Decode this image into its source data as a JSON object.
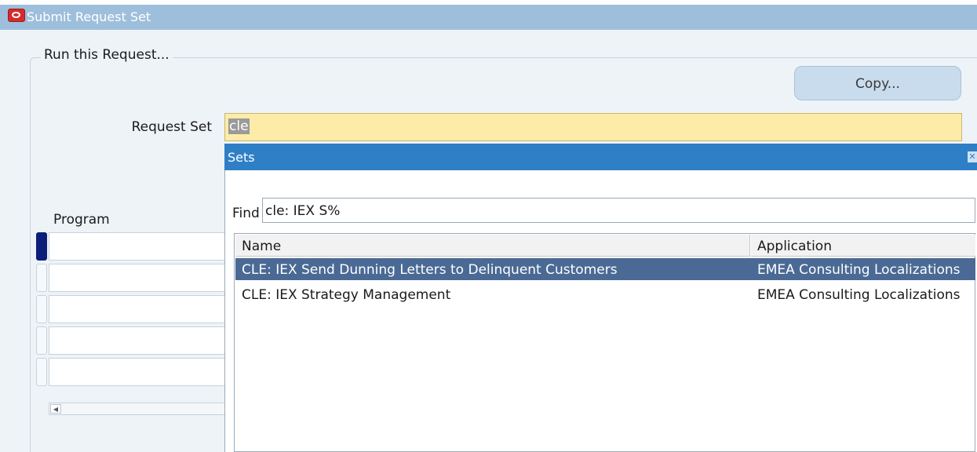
{
  "window": {
    "title": "Submit Request Set"
  },
  "form": {
    "group_label": "Run this Request...",
    "copy_button": "Copy...",
    "request_set_label": "Request Set",
    "request_set_value": "cle",
    "program_label": "Program"
  },
  "sets_dialog": {
    "title": "Sets",
    "find_label": "Find",
    "find_value": "cle: IEX S%",
    "columns": [
      "Name",
      "Application"
    ],
    "rows": [
      {
        "name": "CLE: IEX Send Dunning Letters to Delinquent Customers",
        "application": "EMEA Consulting Localizations"
      },
      {
        "name": "CLE: IEX Strategy Management",
        "application": "EMEA Consulting Localizations"
      }
    ],
    "selected_row_index": 0
  },
  "colors": {
    "title_bar": "#9dbfdc",
    "dialog_title_bar": "#2f7fc6",
    "selected_row": "#4a6a95",
    "required_field": "#fdeba8"
  }
}
